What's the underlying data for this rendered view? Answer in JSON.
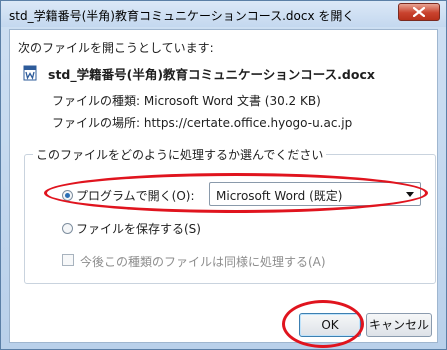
{
  "window": {
    "title": "std_学籍番号(半角)教育コミュニケーションコース.docx を開く"
  },
  "dialog": {
    "intro": "次のファイルを開こうとしています:",
    "file_name": "std_学籍番号(半角)教育コミュニケーションコース.docx",
    "type_label": "ファイルの種類:",
    "type_value": "Microsoft Word 文書 (30.2 KB)",
    "location_label": "ファイルの場所:",
    "location_value": "https://certate.office.hyogo-u.ac.jp",
    "group_title": "このファイルをどのように処理するか選んでください",
    "open_with_label": "プログラムで開く(O):",
    "open_with_value": "Microsoft Word (既定)",
    "save_label": "ファイルを保存する(S)",
    "remember_label": "今後この種類のファイルは同様に処理する(A)",
    "ok_label": "OK",
    "cancel_label": "キャンセル"
  },
  "colors": {
    "highlight_annotation": "#e0141e"
  },
  "icons": {
    "file": "word-document-icon",
    "close": "close-icon"
  }
}
